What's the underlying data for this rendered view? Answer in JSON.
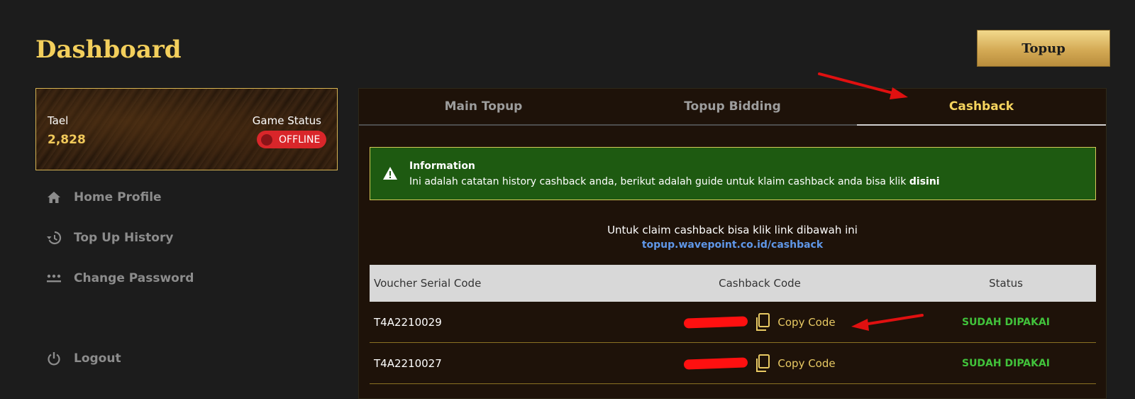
{
  "header": {
    "title": "Dashboard",
    "topup_label": "Topup"
  },
  "profile": {
    "tael_label": "Tael",
    "tael_value": "2,828",
    "status_label": "Game Status",
    "status_value": "OFFLINE"
  },
  "sidebar": {
    "items": [
      {
        "label": "Home Profile",
        "icon": "home-icon"
      },
      {
        "label": "Top Up History",
        "icon": "history-icon"
      },
      {
        "label": "Change Password",
        "icon": "password-icon"
      }
    ],
    "logout_label": "Logout"
  },
  "tabs": [
    {
      "label": "Main Topup"
    },
    {
      "label": "Topup Bidding"
    },
    {
      "label": "Cashback"
    }
  ],
  "info": {
    "title": "Information",
    "text": "Ini adalah catatan history cashback anda, berikut adalah guide untuk klaim cashback anda bisa klik ",
    "link": "disini"
  },
  "claim": {
    "text": "Untuk claim cashback bisa klik link dibawah ini",
    "link": "topup.wavepoint.co.id/cashback"
  },
  "table": {
    "headers": [
      "Voucher Serial Code",
      "Cashback Code",
      "Status"
    ],
    "rows": [
      {
        "serial": "T4A2210029",
        "copy_label": "Copy Code",
        "status": "SUDAH DIPAKAI"
      },
      {
        "serial": "T4A2210027",
        "copy_label": "Copy Code",
        "status": "SUDAH DIPAKAI"
      }
    ]
  },
  "colors": {
    "accent_gold": "#f3cf5c",
    "status_offline": "#d9262a",
    "info_green": "#1e5a11",
    "status_used": "#41c23b",
    "link_blue": "#5f97e8",
    "annotation_red": "#e01010"
  }
}
